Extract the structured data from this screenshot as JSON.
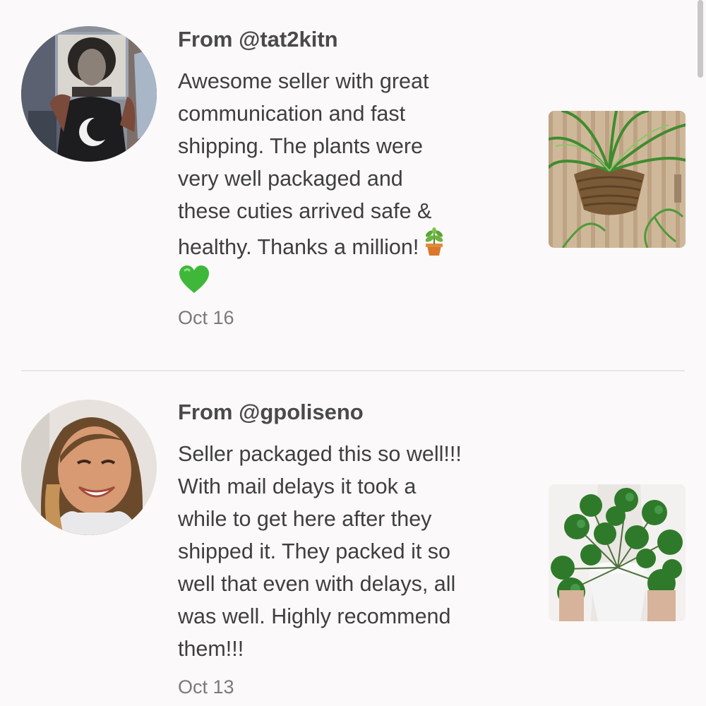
{
  "reviews": [
    {
      "author": "From @tat2kitn",
      "text": "Awesome seller with great\ncommunication and fast\nshipping. The plants were\nvery well packaged and\nthese cuties arrived safe &\nhealthy. Thanks a million!",
      "emojis": [
        "potted-plant-emoji",
        "green-heart-emoji"
      ],
      "date": "Oct 16",
      "avatar_icon": "avatar-photo",
      "photo_icon": "hanging-spider-plant-photo"
    },
    {
      "author": "From @gpoliseno",
      "text": "Seller packaged this so well!!!\nWith mail delays it took a\nwhile to get here after they\nshipped it. They packed it so\nwell that even with delays, all\nwas well. Highly recommend\nthem!!!",
      "date": "Oct 13",
      "avatar_icon": "avatar-photo",
      "photo_icon": "pilea-plant-photo"
    }
  ],
  "colors": {
    "background": "#fbf9fa",
    "text": "#3f3f3f",
    "date": "#7a7a7a",
    "divider": "#e8e6e7"
  }
}
